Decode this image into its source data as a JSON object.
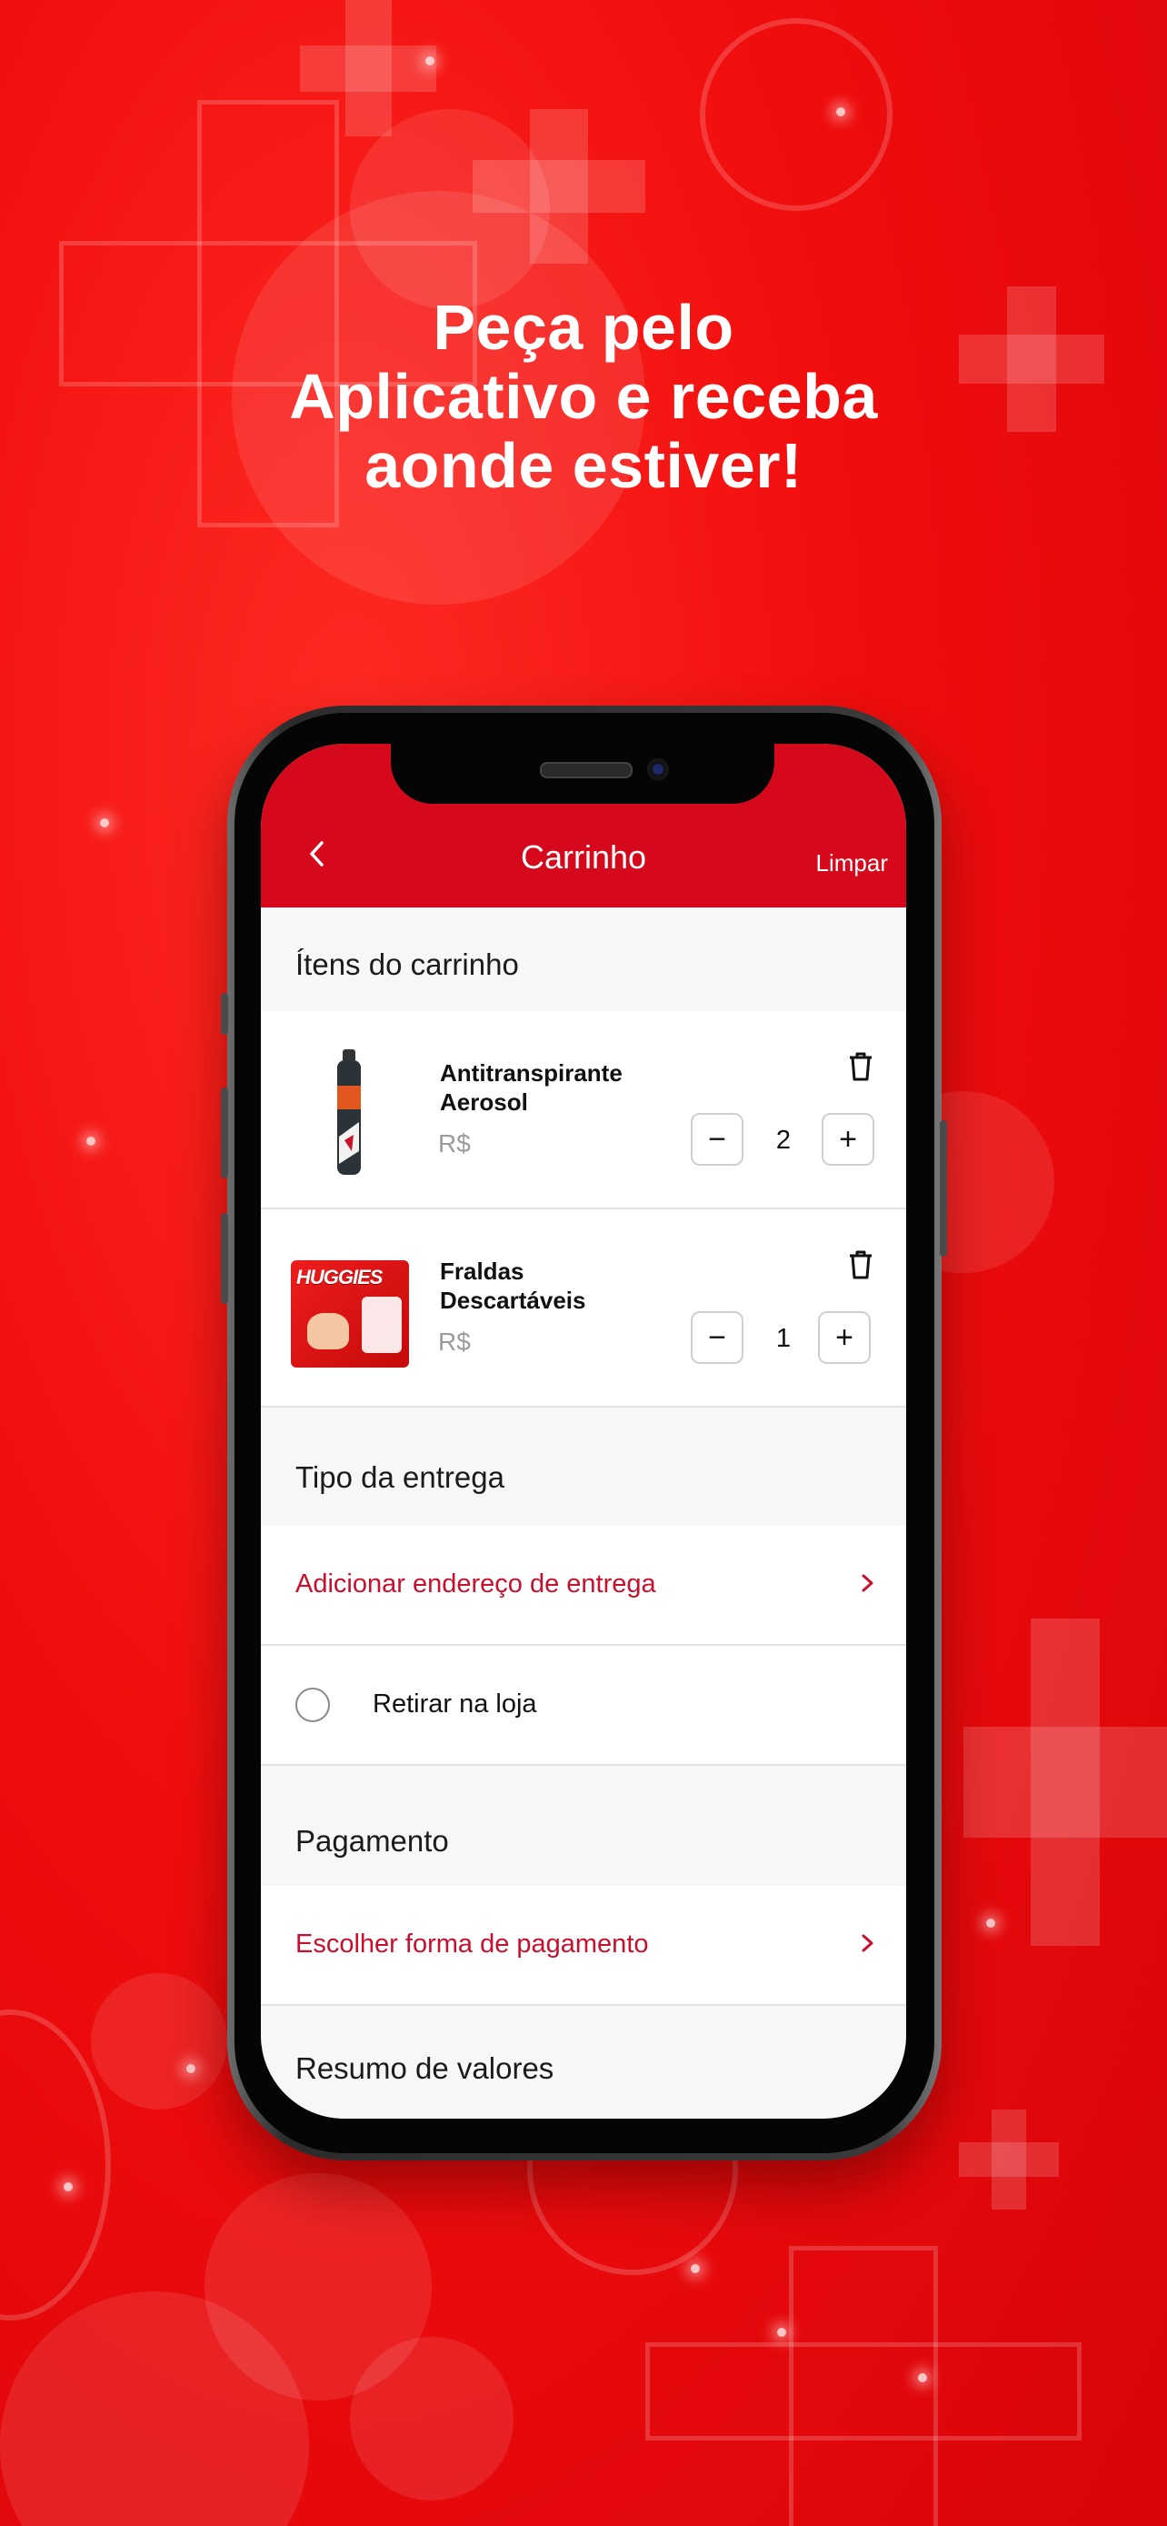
{
  "headline": {
    "line1": "Peça pelo",
    "line2": "Aplicativo e receba",
    "line3": "aonde estiver!"
  },
  "nav": {
    "back_icon": "chevron-left-icon",
    "title": "Carrinho",
    "clear_label": "Limpar"
  },
  "cart": {
    "section_title": "Ítens do carrinho",
    "items": [
      {
        "name": "Antitranspirante Aerosol",
        "price": "R$",
        "quantity": "2",
        "image": "deodorant-image"
      },
      {
        "name": "Fraldas Descartáveis",
        "price": "R$",
        "quantity": "1",
        "image": "diaper-pack-image"
      }
    ],
    "brand_on_image": "HUGGIES"
  },
  "delivery": {
    "section_title": "Tipo da entrega",
    "add_address_label": "Adicionar endereço de entrega",
    "pickup_label": "Retirar na loja"
  },
  "payment": {
    "section_title": "Pagamento",
    "choose_label": "Escolher forma de pagamento"
  },
  "summary": {
    "section_title": "Resumo de valores"
  },
  "colors": {
    "brand_red": "#d5091b",
    "link_red": "#c8102e",
    "background": "#f00d0d"
  }
}
